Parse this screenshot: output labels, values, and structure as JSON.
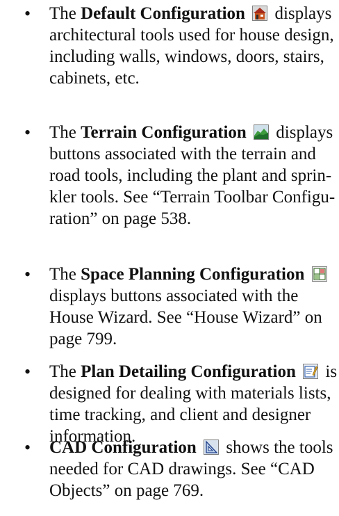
{
  "bullets": [
    {
      "bullet": "•",
      "lines": [
        {
          "pre": "The ",
          "bold": "Default Configuration",
          "post": " displays"
        },
        {
          "text": "architectural tools used for house design,"
        },
        {
          "text": "including walls, windows, doors, stairs,"
        },
        {
          "text": "cabinets, etc."
        }
      ]
    },
    {
      "bullet": "•",
      "lines": [
        {
          "pre": "The ",
          "bold": "Terrain Configuration",
          "post": " displays"
        },
        {
          "text": "buttons associated with the terrain and"
        },
        {
          "text": "road tools, including the plant and sprin-"
        },
        {
          "text": "kler tools. See “Terrain Toolbar Configu-"
        },
        {
          "text": "ration” on page 538."
        }
      ]
    },
    {
      "bullet": "•",
      "lines": [
        {
          "pre": "The ",
          "bold": "Space Planning Configuration",
          "post": ""
        },
        {
          "text": "displays buttons associated with the"
        },
        {
          "text": "House Wizard. See “House Wizard” on"
        },
        {
          "text": "page 799."
        }
      ]
    },
    {
      "bullet": "•",
      "lines": [
        {
          "pre": "The ",
          "bold": "Plan Detailing Configuration",
          "post": " is"
        },
        {
          "text": "designed for dealing with materials lists,"
        },
        {
          "text": "time tracking, and client and designer"
        },
        {
          "text": "information."
        }
      ]
    },
    {
      "bullet": "•",
      "lines": [
        {
          "pre": "",
          "bold": "CAD Configuration",
          "post": " shows the tools"
        },
        {
          "text": "needed for CAD drawings. See “CAD"
        },
        {
          "text": "Objects” on page 769."
        }
      ]
    }
  ],
  "icons": {
    "default": "house-icon",
    "terrain": "terrain-icon",
    "space_planning": "space-planning-icon",
    "plan_detailing": "plan-detailing-icon",
    "cad": "cad-triangle-icon"
  }
}
